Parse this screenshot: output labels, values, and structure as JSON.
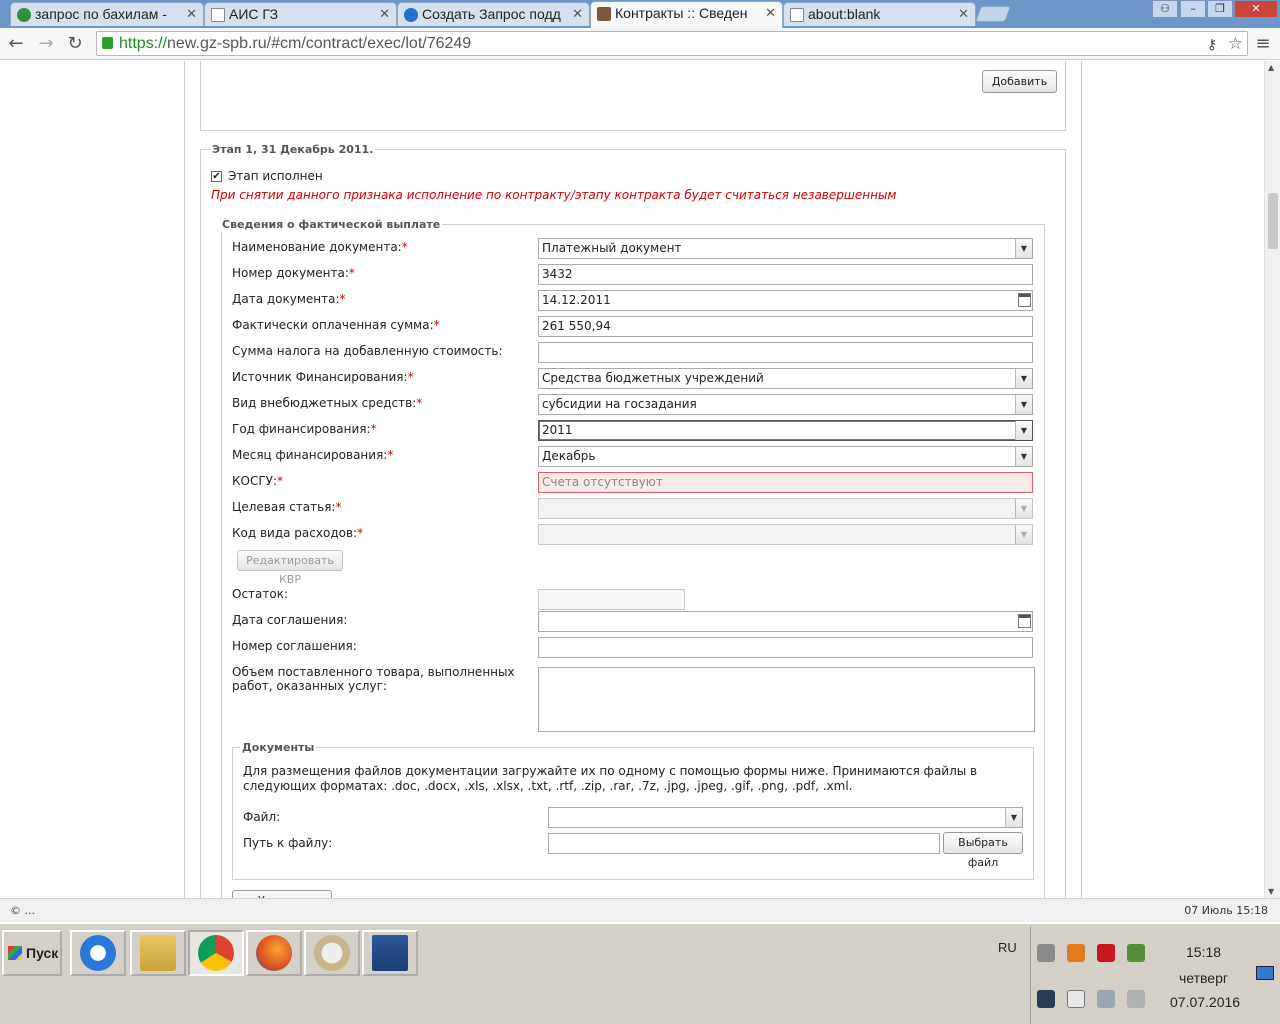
{
  "browser": {
    "tabs": [
      {
        "label": "запрос по бахилам - ",
        "icon_color": "#2f8f3a"
      },
      {
        "label": "АИС ГЗ",
        "icon_color": "#ffffff"
      },
      {
        "label": "Создать Запрос подд",
        "icon_color": "#2a6fc9"
      },
      {
        "label": "Контракты :: Сведен",
        "icon_color": "#7a5a3a"
      },
      {
        "label": "about:blank",
        "icon_color": "#ffffff"
      }
    ],
    "active_tab": 3,
    "url_scheme": "https://",
    "url_rest": "new.gz-spb.ru/#cm/contract/exec/lot/76249"
  },
  "page": {
    "add_button": "Добавить",
    "stage_legend": "Этап 1, 31 Декабрь 2011.",
    "stage_done_label": "Этап исполнен",
    "stage_done_checked": true,
    "warning": "При снятии данного признака исполнение по контракту/этапу контракта будет считаться незавершенным",
    "payment_legend": "Сведения о фактической выплате",
    "fields": {
      "doc_name": {
        "label": "Наименование документа:",
        "required": "*",
        "value": "Платежный документ"
      },
      "doc_number": {
        "label": "Номер документа:",
        "required": "*",
        "value": "3432"
      },
      "doc_date": {
        "label": "Дата документа:",
        "required": "*",
        "value": "14.12.2011"
      },
      "paid_sum": {
        "label": "Фактически оплаченная сумма:",
        "required": "*",
        "value": "261 550,94"
      },
      "vat_sum": {
        "label": "Сумма налога на добавленную стоимость:",
        "value": ""
      },
      "fin_source": {
        "label": "Источник Финансирования:",
        "required": "*",
        "value": "Средства бюджетных учреждений"
      },
      "offbudget": {
        "label": "Вид внебюджетных средств:",
        "required": "*",
        "value": "субсидии на госзадания"
      },
      "fin_year": {
        "label": "Год финансирования:",
        "required": "*",
        "value": "2011"
      },
      "fin_month": {
        "label": "Месяц финансирования:",
        "required": "*",
        "value": "Декабрь"
      },
      "kosgu": {
        "label": "КОСГУ:",
        "required": "*",
        "value": "Счета отсутствуют"
      },
      "target": {
        "label": "Целевая статья:",
        "required": "*",
        "value": ""
      },
      "expense_code": {
        "label": "Код вида расходов:",
        "required": "*",
        "value": ""
      },
      "remainder": {
        "label": "Остаток:",
        "value": ""
      },
      "agr_date": {
        "label": "Дата соглашения:",
        "value": ""
      },
      "agr_number": {
        "label": "Номер соглашения:",
        "value": ""
      },
      "volume": {
        "label": "Объем поставленного товара, выполненных работ, оказанных услуг:",
        "value": ""
      }
    },
    "edit_kvr_button": "Редактировать КВР",
    "docs": {
      "legend": "Документы",
      "help": "Для размещения файлов документации загружайте их по одному с помощью формы ниже. Принимаются файлы в следующих форматах: .doc, .docx, .xls, .xlsx, .txt, .rtf, .zip, .rar, .7z, .jpg, .jpeg, .gif, .png, .pdf, .xml.",
      "file_label": "Файл:",
      "path_label": "Путь к файлу:",
      "choose_button": "Выбрать файл"
    },
    "delete_button": "Удалить"
  },
  "statusbar": {
    "left": "© ...",
    "right": "07 Июль 15:18"
  },
  "taskbar": {
    "start_label": "Пуск",
    "language": "RU",
    "time": "15:18",
    "weekday": "четверг",
    "date": "07.07.2016"
  }
}
